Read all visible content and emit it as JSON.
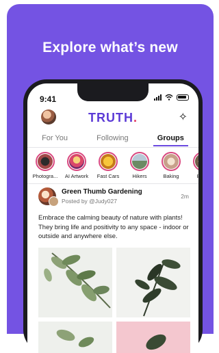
{
  "promo": {
    "headline": "Explore what’s new"
  },
  "status_bar": {
    "time": "9:41"
  },
  "header": {
    "logo_text": "TRUTH",
    "logo_dot": ".",
    "avatar_icon": "profile-avatar",
    "sparkle_icon": "sparkles-icon"
  },
  "tabs": [
    {
      "label": "For You",
      "active": false
    },
    {
      "label": "Following",
      "active": false
    },
    {
      "label": "Groups",
      "active": true
    }
  ],
  "stories": [
    {
      "label": "Photogra...",
      "color": "#8a3b3b"
    },
    {
      "label": "AI Artwork",
      "color": "#d98a3c"
    },
    {
      "label": "Fast Cars",
      "color": "#e0a020"
    },
    {
      "label": "Hikers",
      "color": "#6b8a64"
    },
    {
      "label": "Baking",
      "color": "#c7a08a"
    },
    {
      "label": "Back",
      "color": "#8a7a64"
    }
  ],
  "post": {
    "group_name": "Green Thumb Gardening",
    "posted_by": "Posted by @Judy027",
    "time_ago": "2m",
    "body": "Embrace the calming beauty of nature with plants! They bring life and positivity to any space - indoor or outside and anywhere else."
  },
  "colors": {
    "brand_purple": "#7453e3",
    "logo_purple": "#5b3ad6",
    "story_ring": "#d9477f"
  }
}
